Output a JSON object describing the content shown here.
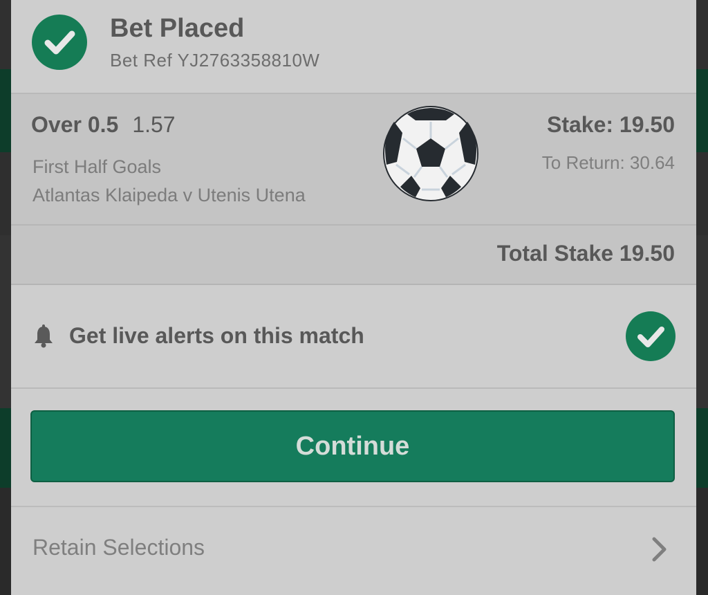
{
  "header": {
    "title": "Bet Placed",
    "bet_ref": "Bet Ref YJ2763358810W"
  },
  "selection": {
    "market": "Over 0.5",
    "odds": "1.57",
    "market_type": "First Half Goals",
    "event": "Atlantas Klaipeda v Utenis Utena",
    "stake": "Stake: 19.50",
    "to_return": "To Return: 30.64",
    "sport_icon": "soccer-ball-icon"
  },
  "total": {
    "label": "Total Stake 19.50"
  },
  "alerts": {
    "label": "Get live alerts on this match",
    "enabled": true
  },
  "actions": {
    "continue_label": "Continue",
    "retain_label": "Retain Selections"
  },
  "colors": {
    "accent_green": "#157c5c",
    "modal_background": "#cecece"
  }
}
